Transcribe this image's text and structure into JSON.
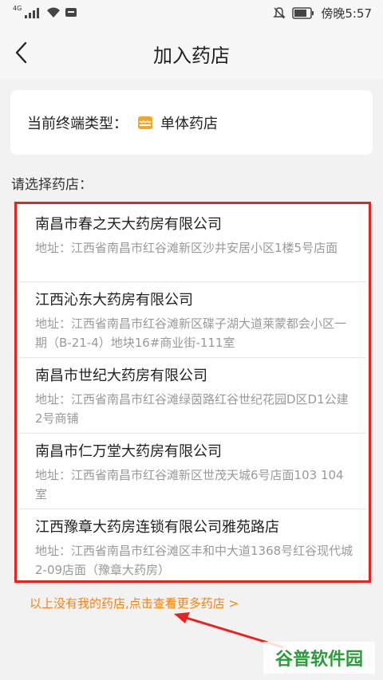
{
  "status_bar": {
    "network": "4G",
    "time": "傍晚5:57"
  },
  "nav": {
    "title": "加入药店"
  },
  "terminal_type": {
    "label": "当前终端类型：",
    "value": "单体药店"
  },
  "select_label": "请选择药店：",
  "pharmacies": [
    {
      "name": "南昌市春之天大药房有限公司",
      "address": "地址：江西省南昌市红谷滩新区沙井安居小区1楼5号店面"
    },
    {
      "name": "江西沁东大药房有限公司",
      "address": "地址：江西省南昌市红谷滩新区碟子湖大道莱蒙都会小区一期（B-21-4）地块16#商业街-111室"
    },
    {
      "name": "南昌市世纪大药房有限公司",
      "address": "地址：江西省南昌市红谷滩绿茵路红谷世纪花园D区D1公建2号商铺"
    },
    {
      "name": "南昌市仁万堂大药房有限公司",
      "address": "地址：江西省南昌市红谷滩新区世茂天城6号店面103 104室"
    },
    {
      "name": "江西豫章大药房连锁有限公司雅苑路店",
      "address": "地址：江西省南昌市红谷滩区丰和中大道1368号红谷现代城2-09店面（豫章大药房）"
    }
  ],
  "more_link": "以上没有我的药店,点击查看更多药店 >",
  "watermark": "谷普软件园",
  "colors": {
    "accent": "#f08519",
    "highlight_border": "#e8221d",
    "watermark": "#2a9d3a"
  },
  "icons": [
    "back-arrow-icon",
    "signal-icon",
    "wifi-icon",
    "message-icon",
    "mute-icon",
    "battery-icon",
    "store-icon"
  ]
}
